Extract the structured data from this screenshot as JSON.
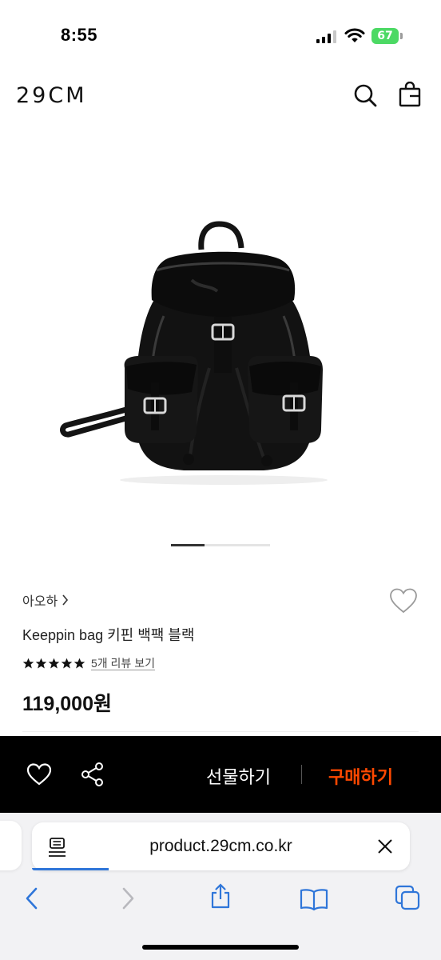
{
  "status_bar": {
    "time": "8:55",
    "battery": "67"
  },
  "header": {
    "logo": "29CM"
  },
  "product": {
    "brand": "아오하",
    "name": "Keeppin bag 키핀 백팩 블랙",
    "rating_stars": 5,
    "review_link": "5개 리뷰 보기",
    "price": "119,000원",
    "image_count_active": 1
  },
  "action_bar": {
    "gift_label": "선물하기",
    "buy_label": "구매하기",
    "buy_color": "#ff4800"
  },
  "browser": {
    "url": "product.29cm.co.kr"
  },
  "colors": {
    "accent": "#ff4800",
    "battery": "#4cd964",
    "progress": "#2f76d9"
  }
}
